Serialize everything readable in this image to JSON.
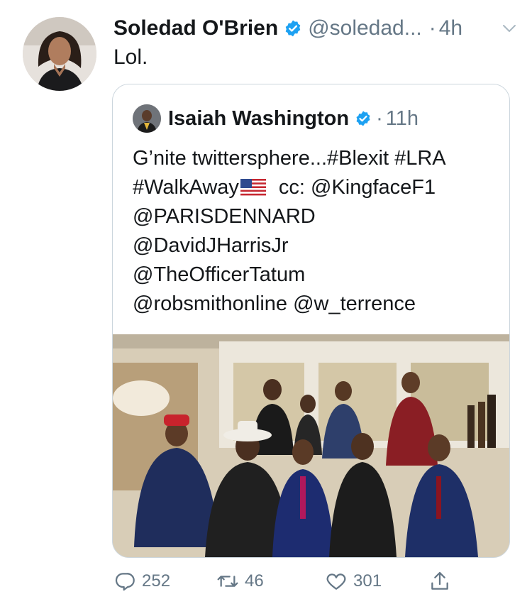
{
  "tweet": {
    "author_name": "Soledad O'Brien",
    "author_handle": "@soledad...",
    "separator": "·",
    "time": "4h",
    "text": "Lol.",
    "avatar_icon": "woman-portrait-avatar",
    "menu_icon": "chevron-down-icon"
  },
  "quoted": {
    "author_name": "Isaiah Washington",
    "separator": "·",
    "time": "11h",
    "lines": [
      "G’nite twittersphere...#Blexit #LRA",
      "#WalkAway",
      "cc: @KingfaceF1",
      "@PARISDENNARD",
      "@DavidJHarrisJr",
      "@TheOfficerTatum",
      "@robsmithonline @w_terrence"
    ],
    "flag_icon": "us-flag-emoji",
    "photo_description_icon": "group-photo-image"
  },
  "actions": {
    "replies": "252",
    "retweets": "46",
    "likes": "301"
  },
  "colors": {
    "text": "#14171a",
    "secondary": "#657786",
    "verified": "#1da1f2",
    "border": "#ccd6dd"
  }
}
